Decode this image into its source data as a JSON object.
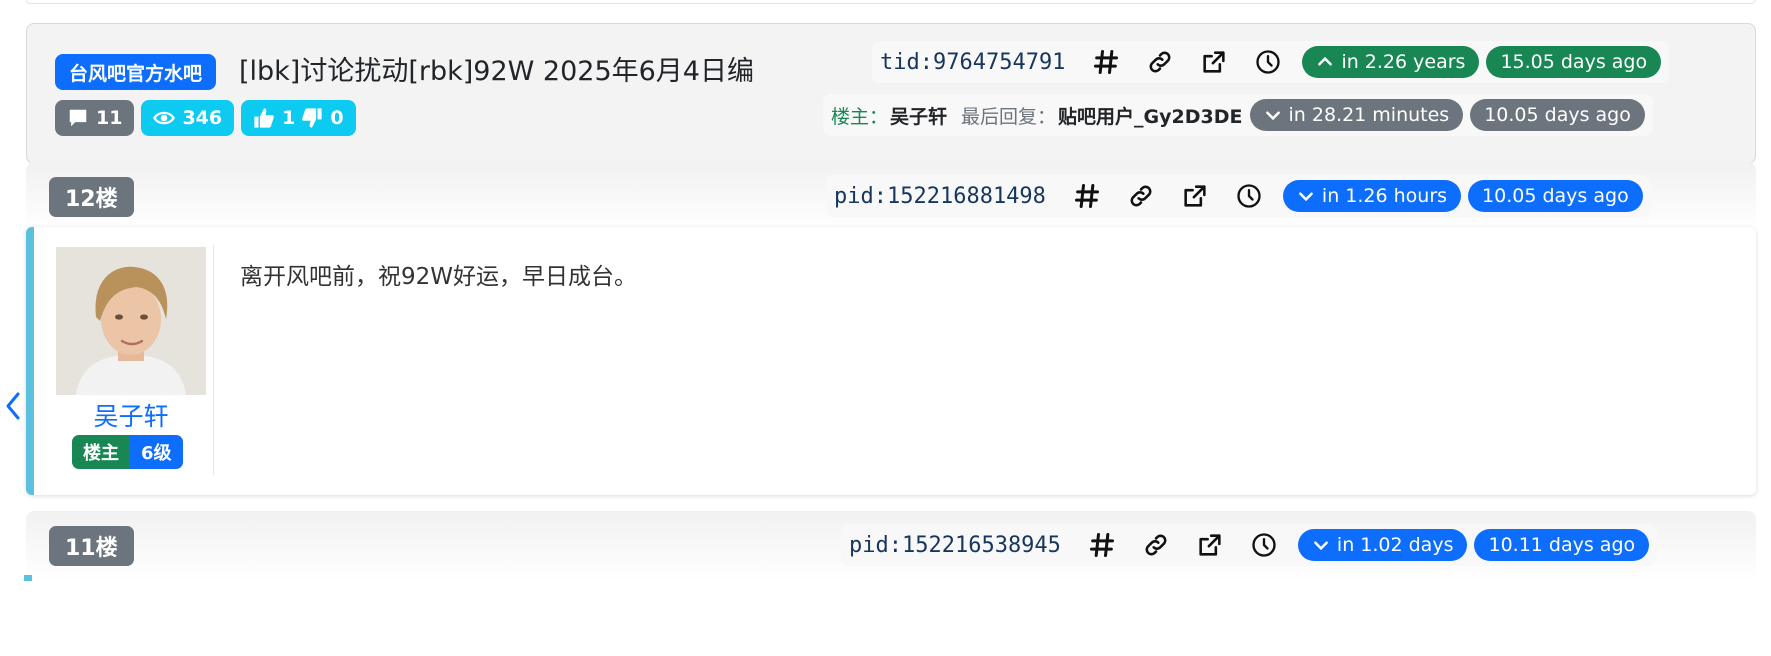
{
  "thread": {
    "forum_badge": "台风吧官方水吧",
    "title": "[lbk]讨论扰动[rbk]92W 2025年6月4日编",
    "tid_text": "tid:9764754791",
    "created_relative": "in 2.26 years",
    "created_ago": "15.05 days ago",
    "stats": {
      "replies": "11",
      "views": "346",
      "likes": "1",
      "dislikes": "0"
    },
    "owner_label": "楼主：",
    "owner_name": "吴子轩",
    "last_reply_label": "最后回复：",
    "last_reply_name": "贴吧用户_Gy2D3DE",
    "last_reply_relative": "in 28.21 minutes",
    "last_reply_ago": "10.05 days ago"
  },
  "posts": [
    {
      "floor": "12楼",
      "pid_text": "pid:152216881498",
      "relative": "in 1.26 hours",
      "ago": "10.05 days ago",
      "author": "吴子轩",
      "owner_tag": "楼主",
      "level_tag": "6级",
      "content": "离开风吧前，祝92W好运，早日成台。"
    },
    {
      "floor": "11楼",
      "pid_text": "pid:152216538945",
      "relative": "in 1.02 days",
      "ago": "10.11 days ago"
    }
  ],
  "icons": [
    "hash-icon",
    "link-icon",
    "external-link-icon",
    "clock-icon",
    "chevron-up-icon",
    "chevron-down-icon",
    "comment-icon",
    "eye-icon",
    "thumbs-up-icon",
    "thumbs-down-icon",
    "chevron-left-icon"
  ],
  "colors": {
    "primary": "#0d6efd",
    "success": "#198754",
    "secondary": "#6c757d",
    "info": "#0dcaf0",
    "post_accent": "#5bc0de"
  }
}
